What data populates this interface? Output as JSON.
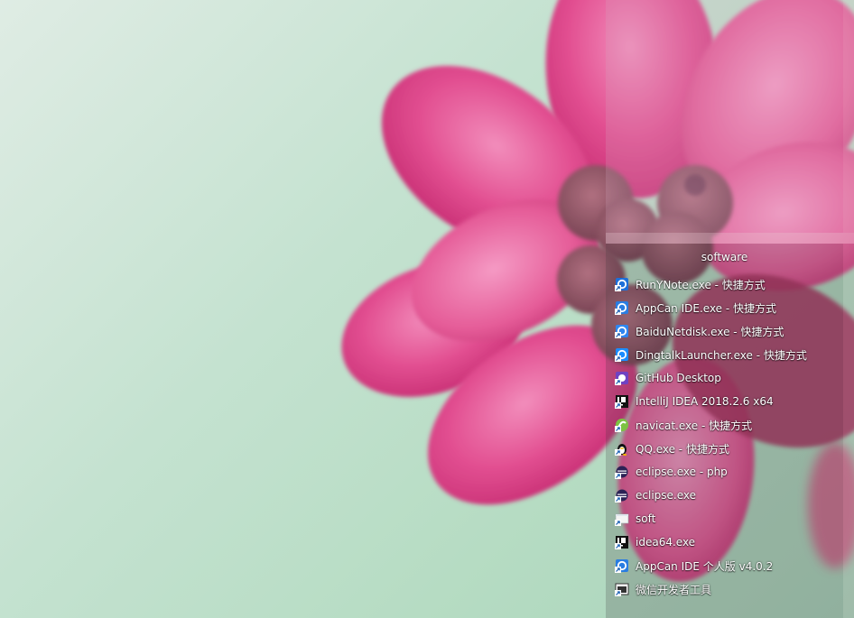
{
  "fence": {
    "title": "software",
    "items": [
      {
        "label": "RunYNote.exe - 快捷方式",
        "icon": "youdao-note-icon",
        "color": "#1d6fd8"
      },
      {
        "label": "AppCan IDE.exe - 快捷方式",
        "icon": "appcan-icon",
        "color": "#2a7de1"
      },
      {
        "label": "BaiduNetdisk.exe - 快捷方式",
        "icon": "baidu-netdisk-icon",
        "color": "#2f86f0"
      },
      {
        "label": "DingtalkLauncher.exe - 快捷方式",
        "icon": "dingtalk-icon",
        "color": "#1a8cff"
      },
      {
        "label": "GitHub Desktop",
        "icon": "github-desktop-icon",
        "color": "#6f42c1"
      },
      {
        "label": "IntelliJ IDEA 2018.2.6 x64",
        "icon": "intellij-idea-icon",
        "color": "#111111"
      },
      {
        "label": "navicat.exe - 快捷方式",
        "icon": "navicat-icon",
        "color": "#7cc242"
      },
      {
        "label": "QQ.exe - 快捷方式",
        "icon": "qq-penguin-icon",
        "color": "#000000"
      },
      {
        "label": "eclipse.exe - php",
        "icon": "eclipse-icon",
        "color": "#2c2255"
      },
      {
        "label": "eclipse.exe",
        "icon": "eclipse-icon",
        "color": "#2c2255"
      },
      {
        "label": "soft",
        "icon": "folder-shortcut-icon",
        "color": "#f2f2f2"
      },
      {
        "label": "idea64.exe",
        "icon": "intellij-idea-icon",
        "color": "#111111"
      },
      {
        "label": "AppCan IDE 个人版 v4.0.2",
        "icon": "appcan-icon",
        "color": "#2a7de1"
      },
      {
        "label": "微信开发者工具",
        "icon": "wechat-devtools-icon",
        "color": "#3a3a3a"
      }
    ]
  }
}
